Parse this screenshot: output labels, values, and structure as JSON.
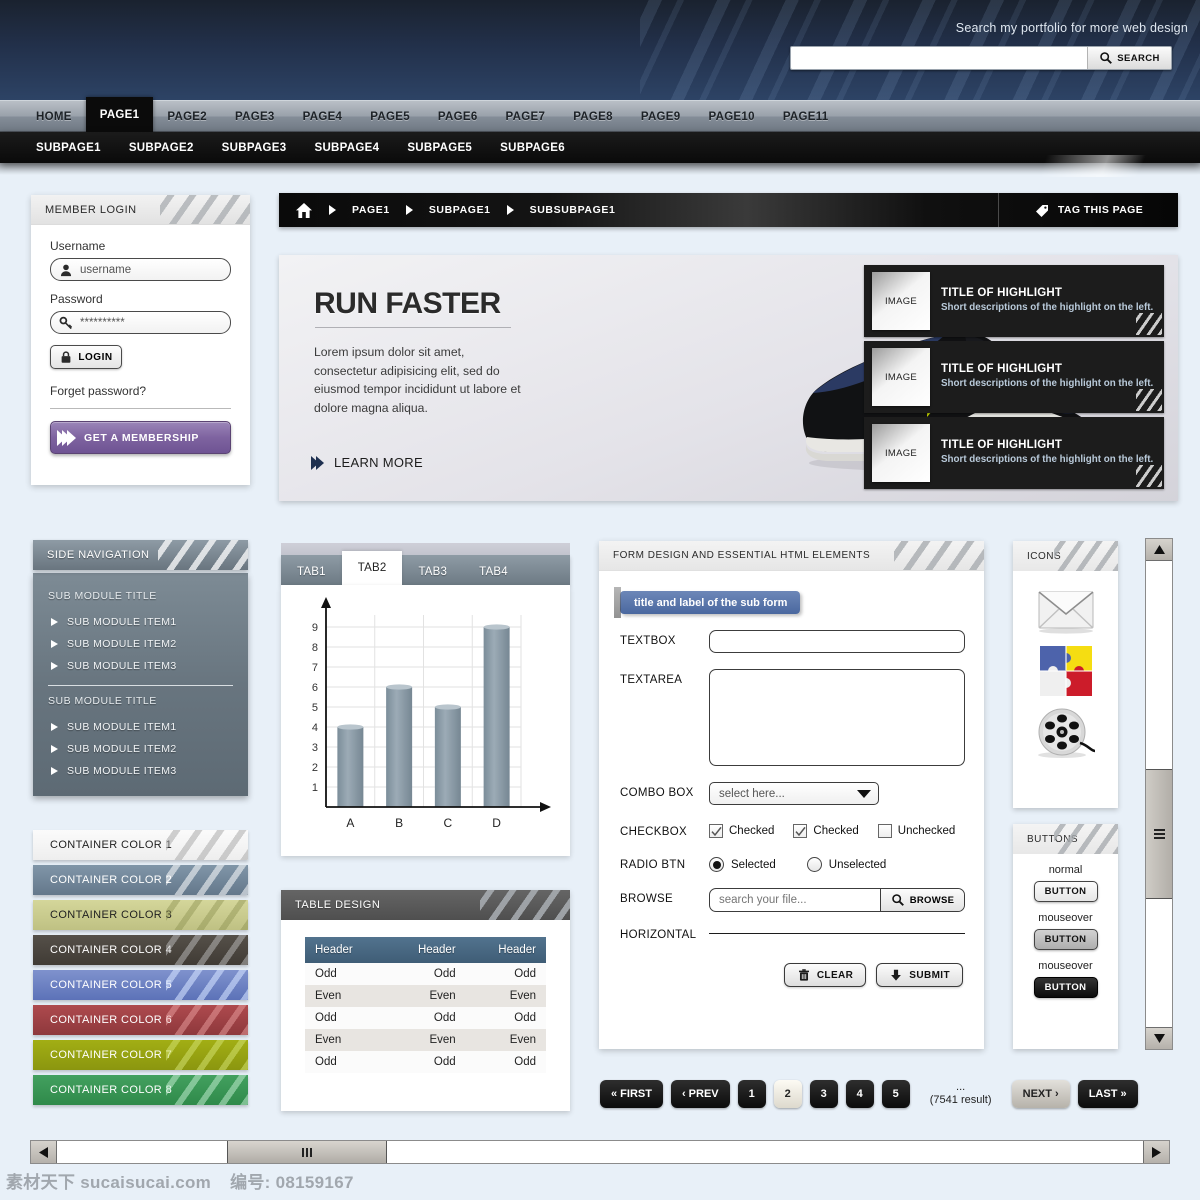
{
  "header": {
    "search_label": "Search my portfolio for more web design",
    "search_placeholder": "",
    "search_value": "",
    "search_button": "SEARCH"
  },
  "mainnav": {
    "items": [
      {
        "label": "HOME",
        "active": false
      },
      {
        "label": "PAGE1",
        "active": true
      },
      {
        "label": "PAGE2",
        "active": false
      },
      {
        "label": "PAGE3",
        "active": false
      },
      {
        "label": "PAGE4",
        "active": false
      },
      {
        "label": "PAGE5",
        "active": false
      },
      {
        "label": "PAGE6",
        "active": false
      },
      {
        "label": "PAGE7",
        "active": false
      },
      {
        "label": "PAGE8",
        "active": false
      },
      {
        "label": "PAGE9",
        "active": false
      },
      {
        "label": "PAGE10",
        "active": false
      },
      {
        "label": "PAGE11",
        "active": false
      }
    ]
  },
  "subnav": {
    "items": [
      "SUBPAGE1",
      "SUBPAGE2",
      "SUBPAGE3",
      "SUBPAGE4",
      "SUBPAGE5",
      "SUBPAGE6"
    ]
  },
  "login": {
    "title": "MEMBER LOGIN",
    "username_label": "Username",
    "username_value": "username",
    "password_label": "Password",
    "password_value": "**********",
    "login_button": "LOGIN",
    "forget_link": "Forget password?",
    "membership_button": "GET A MEMBERSHIP"
  },
  "sidenav": {
    "title": "SIDE NAVIGATION",
    "groups": [
      {
        "title": "SUB MODULE TITLE",
        "items": [
          "SUB MODULE ITEM1",
          "SUB MODULE ITEM2",
          "SUB MODULE ITEM3"
        ]
      },
      {
        "title": "SUB MODULE TITLE",
        "items": [
          "SUB MODULE ITEM1",
          "SUB MODULE ITEM2",
          "SUB MODULE ITEM3"
        ]
      }
    ]
  },
  "containers": [
    {
      "label": "CONTAINER COLOR 1",
      "bg1": "#fbfbfb",
      "bg2": "#eeeeee",
      "fg": "#1f1f1f",
      "stripe": "rgba(170,170,170,0.55)"
    },
    {
      "label": "CONTAINER COLOR 2",
      "bg1": "#8096a8",
      "bg2": "#64788b",
      "fg": "#ffffff",
      "stripe": "rgba(255,255,255,0.55)"
    },
    {
      "label": "CONTAINER COLOR 3",
      "bg1": "#d4d69a",
      "bg2": "#bfc183",
      "fg": "#1f1f1f",
      "stripe": "rgba(140,145,80,0.45)"
    },
    {
      "label": "CONTAINER COLOR 4",
      "bg1": "#555049",
      "bg2": "#403b35",
      "fg": "#ffffff",
      "stripe": "rgba(190,190,190,0.5)"
    },
    {
      "label": "CONTAINER COLOR 5",
      "bg1": "#7f92cd",
      "bg2": "#5c72b8",
      "fg": "#ffffff",
      "stripe": "rgba(210,225,255,0.6)"
    },
    {
      "label": "CONTAINER COLOR 6",
      "bg1": "#ae4a4e",
      "bg2": "#8e383c",
      "fg": "#ffffff",
      "stripe": "rgba(235,160,160,0.5)"
    },
    {
      "label": "CONTAINER COLOR 7",
      "bg1": "#a2ae14",
      "bg2": "#8b960f",
      "fg": "#ffffff",
      "stripe": "rgba(210,225,110,0.55)"
    },
    {
      "label": "CONTAINER COLOR 8",
      "bg1": "#43a05f",
      "bg2": "#2f8a4a",
      "fg": "#ffffff",
      "stripe": "rgba(190,235,205,0.55)"
    }
  ],
  "breadcrumb": {
    "home_icon": "home-icon",
    "items": [
      "PAGE1",
      "SUBPAGE1",
      "SUBSUBPAGE1"
    ],
    "tag_button": "TAG THIS PAGE"
  },
  "banner": {
    "title": "RUN FASTER",
    "text": "Lorem ipsum dolor sit amet, consectetur adipisicing elit, sed do eiusmod tempor incididunt ut labore et dolore magna aliqua.",
    "learn_more": "LEARN MORE",
    "highlights": [
      {
        "image_label": "IMAGE",
        "title": "TITLE OF HIGHLIGHT",
        "desc": "Short descriptions of the highlight on the left."
      },
      {
        "image_label": "IMAGE",
        "title": "TITLE OF HIGHLIGHT",
        "desc": "Short descriptions of the highlight on the left."
      },
      {
        "image_label": "IMAGE",
        "title": "TITLE OF HIGHLIGHT",
        "desc": "Short descriptions of the highlight on the left."
      }
    ]
  },
  "tabs": [
    {
      "label": "TAB1",
      "active": false
    },
    {
      "label": "TAB2",
      "active": true
    },
    {
      "label": "TAB3",
      "active": false
    },
    {
      "label": "TAB4",
      "active": false
    }
  ],
  "chart_data": {
    "type": "bar",
    "categories": [
      "A",
      "B",
      "C",
      "D"
    ],
    "values": [
      4,
      6,
      5,
      9
    ],
    "title": "",
    "xlabel": "",
    "ylabel": "",
    "ylim": [
      0,
      9
    ],
    "yticks": [
      1,
      2,
      3,
      4,
      5,
      6,
      7,
      8,
      9
    ],
    "grid": true,
    "legend": false,
    "bar_color": "#8a9aa6"
  },
  "table": {
    "title": "TABLE DESIGN",
    "headers": [
      "Header",
      "Header",
      "Header"
    ],
    "rows": [
      {
        "cells": [
          "Odd",
          "Odd",
          "Odd"
        ],
        "parity": "odd"
      },
      {
        "cells": [
          "Even",
          "Even",
          "Even"
        ],
        "parity": "even"
      },
      {
        "cells": [
          "Odd",
          "Odd",
          "Odd"
        ],
        "parity": "odd"
      },
      {
        "cells": [
          "Even",
          "Even",
          "Even"
        ],
        "parity": "even"
      },
      {
        "cells": [
          "Odd",
          "Odd",
          "Odd"
        ],
        "parity": "odd"
      }
    ]
  },
  "form": {
    "title": "FORM DESIGN AND ESSENTIAL HTML ELEMENTS",
    "subform_title": "title and label of the sub form",
    "textbox_label": "TEXTBOX",
    "textbox_value": "",
    "textarea_label": "TEXTAREA",
    "textarea_value": "",
    "combo_label": "COMBO BOX",
    "combo_value": "select here...",
    "checkbox_label": "CHECKBOX",
    "checkboxes": [
      {
        "label": "Checked",
        "checked": true
      },
      {
        "label": "Checked",
        "checked": true
      },
      {
        "label": "Unchecked",
        "checked": false
      }
    ],
    "radio_label": "RADIO BTN",
    "radios": [
      {
        "label": "Selected",
        "selected": true
      },
      {
        "label": "Unselected",
        "selected": false
      }
    ],
    "browse_label": "BROWSE",
    "browse_placeholder": "search your file...",
    "browse_value": "",
    "browse_button": "BROWSE",
    "horizontal_label": "HORIZONTAL",
    "clear_button": "CLEAR",
    "submit_button": "SUBMIT"
  },
  "icons": {
    "title": "ICONS",
    "items": [
      "envelope-icon",
      "puzzle-icon",
      "film-reel-icon"
    ]
  },
  "buttons": {
    "title": "BUTTONS",
    "states": [
      {
        "state": "normal",
        "label": "BUTTON",
        "style": "normal"
      },
      {
        "state": "mouseover",
        "label": "BUTTON",
        "style": "over"
      },
      {
        "state": "mouseover",
        "label": "BUTTON",
        "style": "dark"
      }
    ]
  },
  "pager": {
    "first": "FIRST",
    "prev": "PREV",
    "pages": [
      "1",
      "2",
      "3",
      "4",
      "5"
    ],
    "current": "2",
    "ellipsis": "...",
    "result": "(7541 result)",
    "next": "NEXT",
    "last": "LAST"
  },
  "watermark": {
    "site": "素材天下 sucaisucai.com",
    "code": "编号: 08159167"
  }
}
